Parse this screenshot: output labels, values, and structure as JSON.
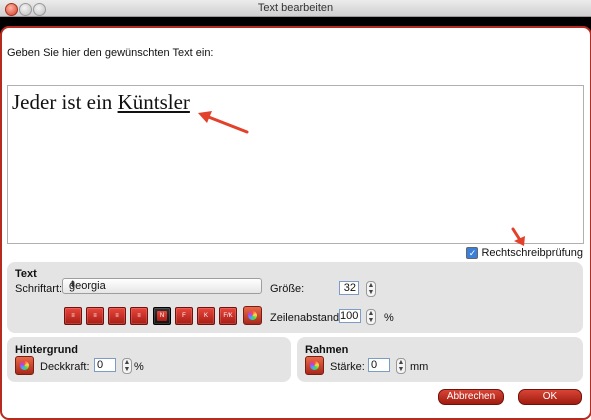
{
  "window": {
    "title": "Text bearbeiten"
  },
  "prompt": "Geben Sie hier den gewünschten Text ein:",
  "editor": {
    "text_plain": "Jeder ist ein ",
    "text_underlined": "Küntsler"
  },
  "spellcheck": {
    "label": "Rechtschreibprüfung",
    "checked": true
  },
  "text_panel": {
    "header": "Text",
    "font_label": "Schriftart:",
    "font_value": "georgia",
    "size_label": "Größe:",
    "size_value": "32",
    "line_spacing_label": "Zeilenabstand:",
    "line_spacing_value": "100",
    "percent": "%",
    "format_buttons": [
      "align-left",
      "align-center",
      "align-right",
      "align-justify",
      "N",
      "F",
      "K",
      "F/K"
    ]
  },
  "background_panel": {
    "header": "Hintergrund",
    "opacity_label": "Deckkraft:",
    "opacity_value": "0",
    "percent": "%"
  },
  "border_panel": {
    "header": "Rahmen",
    "thickness_label": "Stärke:",
    "thickness_value": "0",
    "unit": "mm"
  },
  "buttons": {
    "cancel": "Abbrechen",
    "ok": "OK"
  },
  "colors": {
    "accent": "#b62b1f",
    "panel": "#e4e4e4",
    "arrow": "#e2412b"
  }
}
